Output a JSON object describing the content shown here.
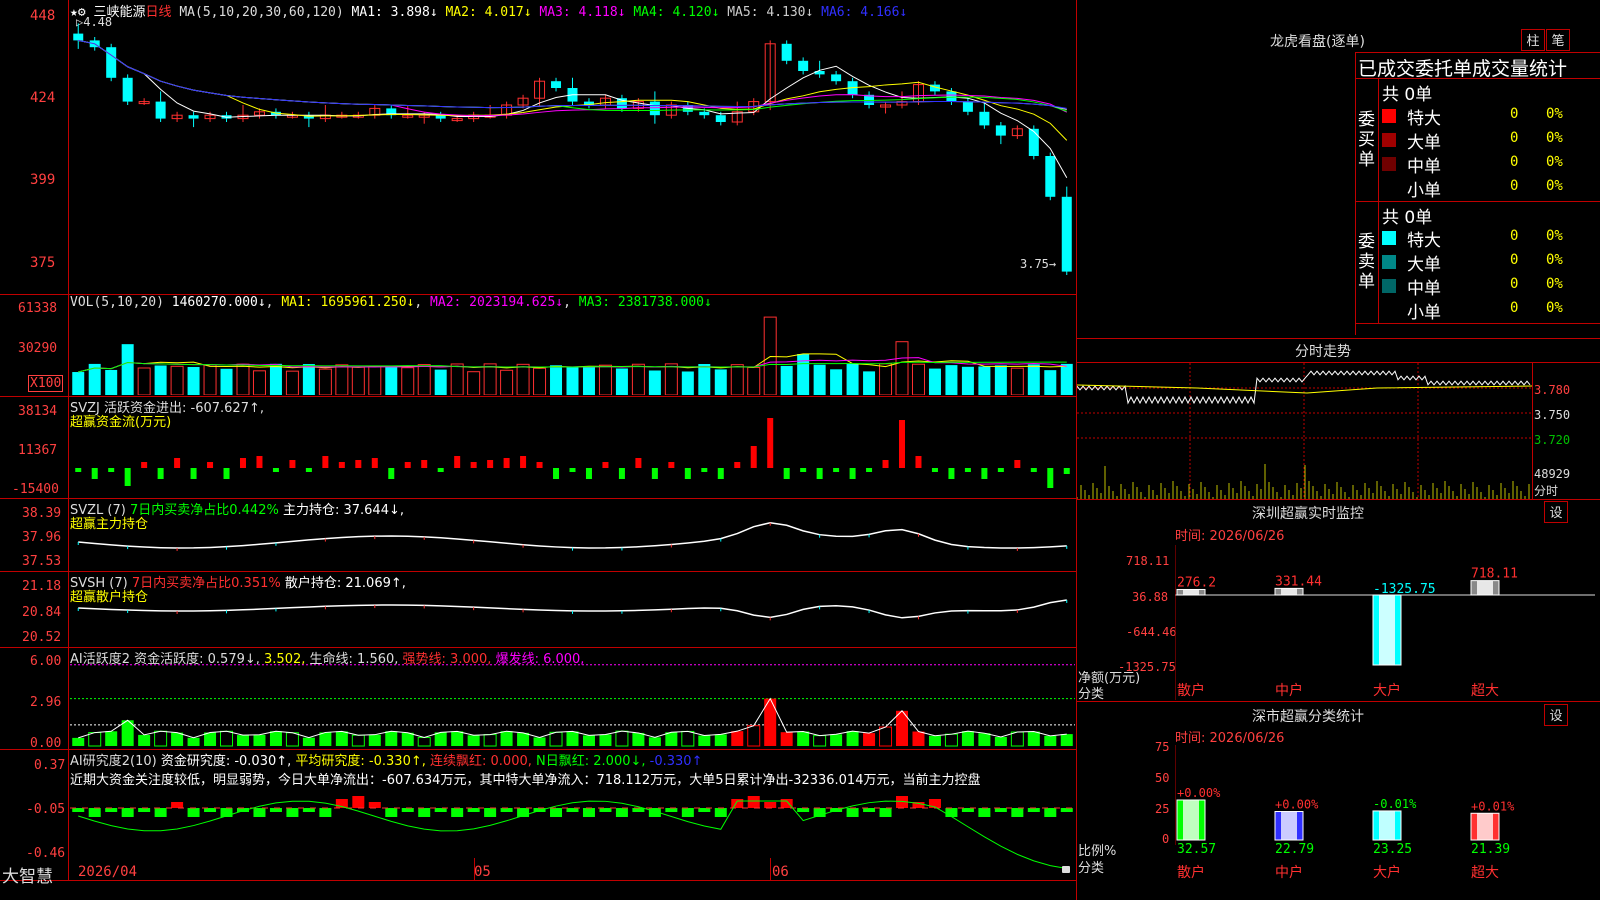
{
  "header": {
    "stock_name": "三峡能源",
    "period": "日线",
    "ma_label": "MA(5,10,20,30,60,120)",
    "ma": [
      {
        "label": "MA1: 3.898↓",
        "color": "#ffffff"
      },
      {
        "label": "MA2: 4.017↓",
        "color": "#ffff00"
      },
      {
        "label": "MA3: 4.118↓",
        "color": "#ff00ff"
      },
      {
        "label": "MA4: 4.120↓",
        "color": "#00ff00"
      },
      {
        "label": "MA5: 4.130↓",
        "color": "#cccccc"
      },
      {
        "label": "MA6: 4.166↓",
        "color": "#3030ff"
      }
    ],
    "max_marker": "4.48",
    "min_marker": "3.75"
  },
  "price_axis": [
    "448",
    "424",
    "399",
    "375"
  ],
  "vol_panel": {
    "axis": [
      "61338",
      "30290",
      "X100"
    ],
    "title": "VOL(5,10,20)",
    "value": "1460270.000↓",
    "ma1": "MA1: 1695961.250↓",
    "ma2": "MA2: 2023194.625↓",
    "ma3": "MA3: 2381738.000↓"
  },
  "svzj_panel": {
    "axis": [
      "38134",
      "11367",
      "-15400"
    ],
    "title": "SVZJ  活跃资金进出: -607.627↑,",
    "subtitle": "超赢资金流(万元)"
  },
  "svzl_panel": {
    "axis": [
      "38.39",
      "37.96",
      "37.53"
    ],
    "title": "SVZL (7)",
    "ratio": "7日内买卖净占比0.442%",
    "holding": "主力持仓: 37.644↓,",
    "subtitle": "超赢主力持仓"
  },
  "svsh_panel": {
    "axis": [
      "21.18",
      "20.84",
      "20.52"
    ],
    "title": "SVSH (7)",
    "ratio": "7日内买卖净占比0.351%",
    "holding": "散户持仓: 21.069↑,",
    "subtitle": "超赢散户持仓"
  },
  "ai_panel": {
    "axis": [
      "6.00",
      "2.96",
      "0.00"
    ],
    "title": "AI活跃度2",
    "fund": "资金活跃度: 0.579↓",
    "v2": "3.502,",
    "life": "生命线: 1.560,",
    "strong": "强势线: 3.000,",
    "burst": "爆发线: 6.000,"
  },
  "research_panel": {
    "axis": [
      "0.37",
      "-0.05",
      "-0.46"
    ],
    "title": "AI研究度2(10)",
    "r1": "资金研究度: -0.030↑,",
    "r2": "平均研究度: -0.330↑,",
    "r3": "连续飘红: 0.000,",
    "r4": "N日飘红: 2.000↓,",
    "r5": "-0.330↑",
    "commentary": "近期大资金关注度较低，明显弱势，今日大单净流出：-607.634万元，其中特大单净流入：718.112万元，大单5日累计净出-32336.014万元，当前主力控盘"
  },
  "bottom": {
    "brand": "大智慧",
    "dates": [
      "2026/04",
      "05",
      "06"
    ]
  },
  "dragon": {
    "title": "龙虎看盘(逐单)",
    "btn1": "柱",
    "btn2": "笔",
    "heading": "已成交委托单成交量统计",
    "buy_label": "委买单",
    "sell_label": "委卖单",
    "buy_total": "共 0单",
    "sell_total": "共 0单",
    "buy_rows": [
      {
        "name": "特大",
        "val": "0",
        "pct": "0%",
        "color": "#ff0000"
      },
      {
        "name": "大单",
        "val": "0",
        "pct": "0%",
        "color": "#a00000"
      },
      {
        "name": "中单",
        "val": "0",
        "pct": "0%",
        "color": "#700000"
      },
      {
        "name": "小单",
        "val": "0",
        "pct": "0%",
        "color": ""
      }
    ],
    "sell_rows": [
      {
        "name": "特大",
        "val": "0",
        "pct": "0%",
        "color": "#00ffff"
      },
      {
        "name": "大单",
        "val": "0",
        "pct": "0%",
        "color": "#008888"
      },
      {
        "name": "中单",
        "val": "0",
        "pct": "0%",
        "color": "#006666"
      },
      {
        "name": "小单",
        "val": "0",
        "pct": "0%",
        "color": ""
      }
    ]
  },
  "intraday": {
    "title": "分时走势",
    "axis": [
      "3.780",
      "3.750",
      "3.720",
      "48929",
      "分时"
    ]
  },
  "monitor": {
    "title": "深圳超赢实时监控",
    "btn": "设",
    "time": "时间: 2026/06/26",
    "axis": [
      "718.11",
      "36.88",
      "-644.46",
      "-1325.75"
    ],
    "ylabel": "净额(万元)",
    "xlabel": "分类",
    "chart_data": {
      "type": "bar",
      "categories": [
        "散户",
        "中户",
        "大户",
        "超大"
      ],
      "values": [
        276.2,
        331.44,
        -1325.75,
        718.11
      ],
      "labels": [
        "276.2",
        "331.44",
        "-1325.75",
        "718.11"
      ],
      "ylim": [
        -1325.75,
        718.11
      ]
    }
  },
  "classify": {
    "title": "深市超赢分类统计",
    "btn": "设",
    "time": "时间: 2026/06/26",
    "axis": [
      "75",
      "50",
      "25",
      "0"
    ],
    "ylabel": "比例%",
    "xlabel": "分类",
    "chart_data": {
      "type": "bar",
      "categories": [
        "散户",
        "中户",
        "大户",
        "超大"
      ],
      "values": [
        32.57,
        22.79,
        23.25,
        21.39
      ],
      "changes": [
        "+0.00%",
        "+0.00%",
        "-0.01%",
        "+0.01%"
      ],
      "ylim": [
        0,
        75
      ]
    }
  },
  "chart_data": {
    "type": "candlestick",
    "price_ylim": [
      3.75,
      4.48
    ],
    "closes": [
      4.44,
      4.42,
      4.33,
      4.26,
      4.26,
      4.21,
      4.22,
      4.21,
      4.22,
      4.21,
      4.22,
      4.23,
      4.22,
      4.22,
      4.21,
      4.22,
      4.22,
      4.22,
      4.24,
      4.22,
      4.22,
      4.22,
      4.21,
      4.21,
      4.22,
      4.22,
      4.25,
      4.27,
      4.32,
      4.3,
      4.26,
      4.25,
      4.27,
      4.24,
      4.26,
      4.22,
      4.25,
      4.23,
      4.22,
      4.2,
      4.23,
      4.26,
      4.43,
      4.38,
      4.35,
      4.34,
      4.32,
      4.28,
      4.25,
      4.25,
      4.26,
      4.31,
      4.29,
      4.26,
      4.23,
      4.19,
      4.16,
      4.18,
      4.1,
      3.98,
      3.76
    ]
  }
}
